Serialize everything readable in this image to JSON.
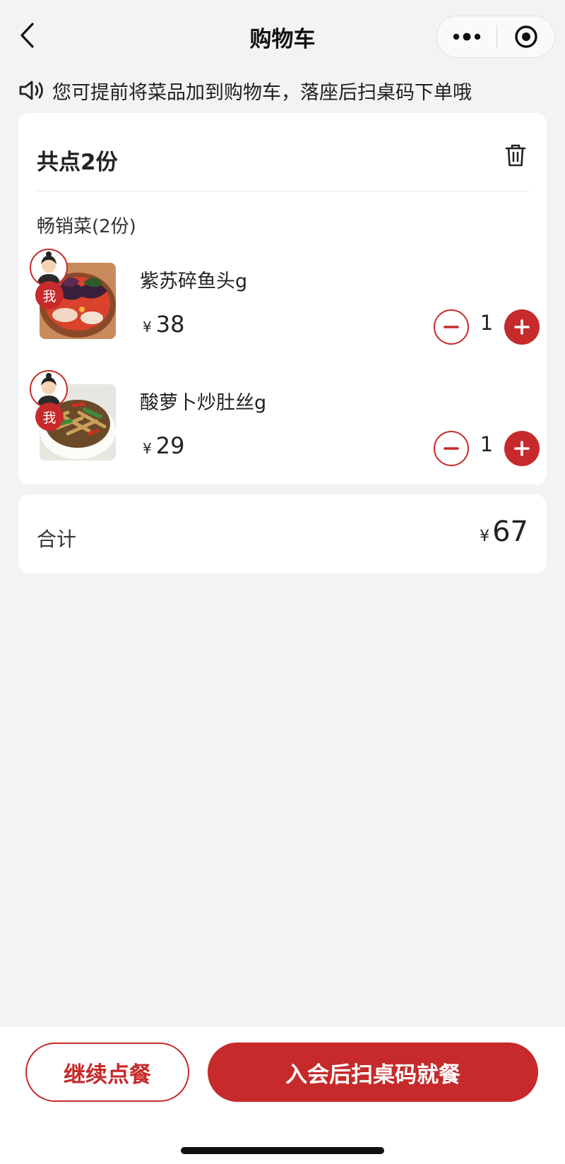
{
  "navbar": {
    "title": "购物车",
    "back_icon": "chevron-left-icon",
    "more_icon": "more-dots-icon",
    "target_icon": "target-icon"
  },
  "notice": {
    "icon": "speaker-icon",
    "text": "您可提前将菜品加到购物车，落座后扫桌码下单哦"
  },
  "cart": {
    "summary": "共点2份",
    "delete_icon": "trash-icon",
    "group_title": "畅销菜(2份)",
    "items": [
      {
        "name": "紫苏碎鱼头g",
        "currency": "¥",
        "price": "38",
        "quantity": "1",
        "owner_badge": "我"
      },
      {
        "name": "酸萝卜炒肚丝g",
        "currency": "¥",
        "price": "29",
        "quantity": "1",
        "owner_badge": "我"
      }
    ]
  },
  "total": {
    "label": "合计",
    "currency": "¥",
    "amount": "67"
  },
  "bottom": {
    "continue_label": "继续点餐",
    "dine_label": "入会后扫桌码就餐"
  },
  "colors": {
    "accent": "#c62a2a",
    "background": "#f3f3f3",
    "card": "#ffffff"
  }
}
